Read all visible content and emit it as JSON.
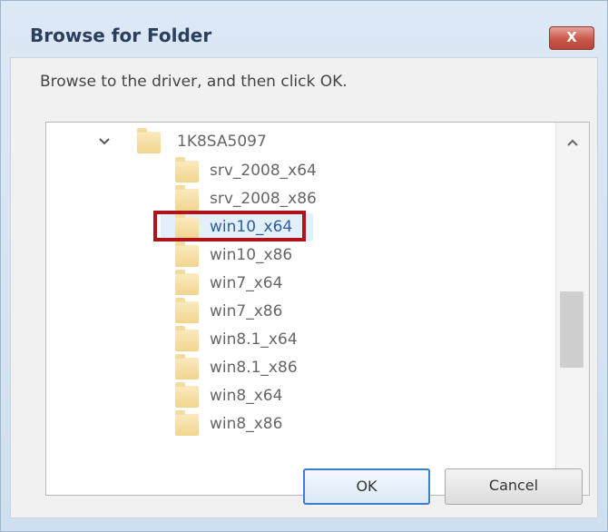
{
  "window": {
    "title": "Browse for Folder",
    "close_label": "X"
  },
  "dialog": {
    "instruction": "Browse to the driver, and then click OK."
  },
  "tree": {
    "parent": {
      "label": "1K8SA5097",
      "expanded": true
    },
    "children": [
      {
        "label": "srv_2008_x64"
      },
      {
        "label": "srv_2008_x86"
      },
      {
        "label": "win10_x64",
        "selected": true
      },
      {
        "label": "win10_x86"
      },
      {
        "label": "win7_x64"
      },
      {
        "label": "win7_x86"
      },
      {
        "label": "win8.1_x64"
      },
      {
        "label": "win8.1_x86"
      },
      {
        "label": "win8_x64"
      },
      {
        "label": "win8_x86"
      }
    ]
  },
  "buttons": {
    "ok_label": "OK",
    "cancel_label": "Cancel"
  },
  "colors": {
    "selection_marker": "#b0131a",
    "selected_text": "#2c5f9e"
  }
}
